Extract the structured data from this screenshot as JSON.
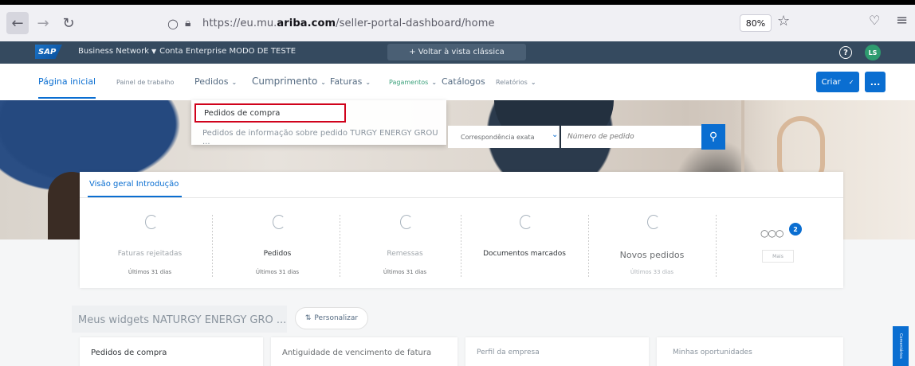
{
  "browser": {
    "url_prefix": "https://eu.mu.",
    "url_domain": "ariba.com",
    "url_path": "/seller-portal-dashboard/home",
    "zoom": "80%"
  },
  "shell": {
    "logo": "SAP",
    "title": "Business Network",
    "account": "Conta Enterprise MODO DE TESTE",
    "classic_view": "+ Voltar à vista clássica",
    "help": "?",
    "avatar": "LS"
  },
  "nav": {
    "items": [
      {
        "label": "Página inicial"
      },
      {
        "label": "Painel de trabalho"
      },
      {
        "label": "Pedidos"
      },
      {
        "label": "Cumprimento"
      },
      {
        "label": "Faturas"
      },
      {
        "label": "Pagamentos"
      },
      {
        "label": "Catálogos"
      },
      {
        "label": "Relatórios"
      }
    ],
    "create": "Criar",
    "more": "..."
  },
  "dropdown": {
    "item1": "Pedidos de compra",
    "item2": "Pedidos de informação sobre pedido TURGY ENERGY GROU ..."
  },
  "search": {
    "match": "Correspondência exata",
    "placeholder": "Número de pedido"
  },
  "overview": {
    "tab": "Visão geral Introdução",
    "tiles": [
      {
        "label": "Faturas rejeitadas",
        "sub": "Últimos 31 dias"
      },
      {
        "label": "Pedidos",
        "sub": "Últimos 31 dias"
      },
      {
        "label": "Remessas",
        "sub": "Últimos 31 dias"
      },
      {
        "label": "Documentos marcados",
        "sub": ""
      },
      {
        "label": "Novos pedidos",
        "sub": "Últimos 33 dias"
      },
      {
        "label": "Mais",
        "badge": "2"
      }
    ]
  },
  "widgets": {
    "title": "Meus widgets NATURGY ENERGY GRO ...",
    "customize": "Personalizar",
    "cards": [
      {
        "title": "Pedidos de compra"
      },
      {
        "title": "Antiguidade de vencimento de fatura"
      },
      {
        "title": "Perfil da empresa"
      },
      {
        "title": "Minhas oportunidades"
      }
    ]
  },
  "feedback": "Comentários"
}
